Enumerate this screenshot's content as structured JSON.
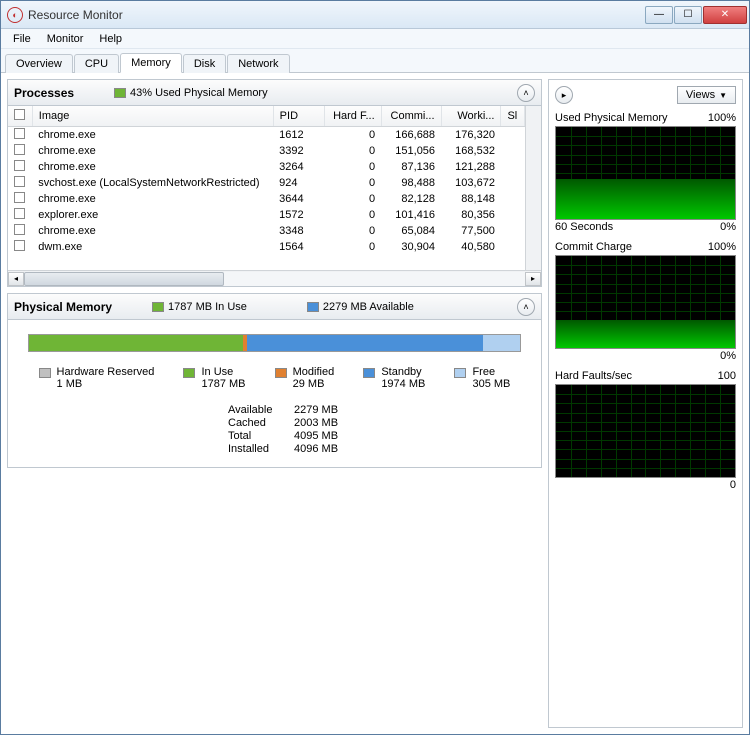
{
  "title": "Resource Monitor",
  "menu": {
    "file": "File",
    "monitor": "Monitor",
    "help": "Help"
  },
  "tabs": {
    "overview": "Overview",
    "cpu": "CPU",
    "memory": "Memory",
    "disk": "Disk",
    "network": "Network"
  },
  "processes": {
    "title": "Processes",
    "status": "43% Used Physical Memory",
    "status_color": "#6fb536",
    "headers": {
      "image": "Image",
      "pid": "PID",
      "hardf": "Hard F...",
      "commit": "Commi...",
      "working": "Worki...",
      "sl": "Sl"
    },
    "rows": [
      {
        "image": "chrome.exe",
        "pid": "1612",
        "hardf": "0",
        "commit": "166,688",
        "working": "176,320"
      },
      {
        "image": "chrome.exe",
        "pid": "3392",
        "hardf": "0",
        "commit": "151,056",
        "working": "168,532"
      },
      {
        "image": "chrome.exe",
        "pid": "3264",
        "hardf": "0",
        "commit": "87,136",
        "working": "121,288"
      },
      {
        "image": "svchost.exe (LocalSystemNetworkRestricted)",
        "pid": "924",
        "hardf": "0",
        "commit": "98,488",
        "working": "103,672"
      },
      {
        "image": "chrome.exe",
        "pid": "3644",
        "hardf": "0",
        "commit": "82,128",
        "working": "88,148"
      },
      {
        "image": "explorer.exe",
        "pid": "1572",
        "hardf": "0",
        "commit": "101,416",
        "working": "80,356"
      },
      {
        "image": "chrome.exe",
        "pid": "3348",
        "hardf": "0",
        "commit": "65,084",
        "working": "77,500"
      },
      {
        "image": "dwm.exe",
        "pid": "1564",
        "hardf": "0",
        "commit": "30,904",
        "working": "40,580"
      }
    ]
  },
  "physical": {
    "title": "Physical Memory",
    "inuse_status": "1787 MB In Use",
    "inuse_color": "#6fb536",
    "avail_status": "2279 MB Available",
    "avail_color": "#4a90d9",
    "bar": {
      "hardware": {
        "label": "Hardware Reserved",
        "value": "1 MB",
        "color": "#c0c0c0",
        "pct": 0.03
      },
      "inuse": {
        "label": "In Use",
        "value": "1787 MB",
        "color": "#6fb536",
        "pct": 43.6
      },
      "modified": {
        "label": "Modified",
        "value": "29 MB",
        "color": "#e08030",
        "pct": 0.7
      },
      "standby": {
        "label": "Standby",
        "value": "1974 MB",
        "color": "#4a90d9",
        "pct": 48.2
      },
      "free": {
        "label": "Free",
        "value": "305 MB",
        "color": "#b0d0f0",
        "pct": 7.4
      }
    },
    "summary": {
      "available_l": "Available",
      "available_v": "2279 MB",
      "cached_l": "Cached",
      "cached_v": "2003 MB",
      "total_l": "Total",
      "total_v": "4095 MB",
      "installed_l": "Installed",
      "installed_v": "4096 MB"
    }
  },
  "right": {
    "views": "Views",
    "graphs": [
      {
        "title": "Used Physical Memory",
        "max": "100%",
        "fill": 43,
        "foot_l": "60 Seconds",
        "foot_r": "0%"
      },
      {
        "title": "Commit Charge",
        "max": "100%",
        "fill": 30,
        "foot_l": "",
        "foot_r": "0%"
      },
      {
        "title": "Hard Faults/sec",
        "max": "100",
        "fill": 0,
        "foot_l": "",
        "foot_r": "0"
      }
    ]
  }
}
